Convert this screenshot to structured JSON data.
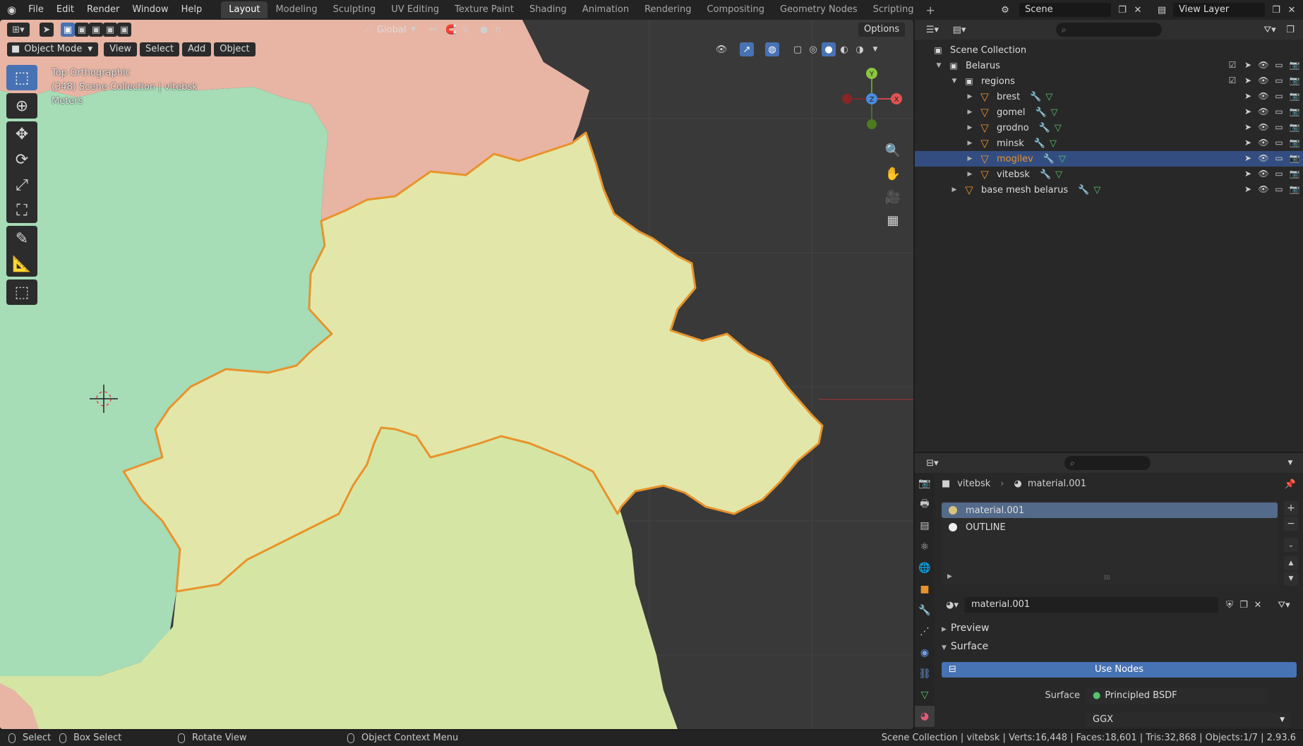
{
  "menus": [
    "File",
    "Edit",
    "Render",
    "Window",
    "Help"
  ],
  "workspaces": [
    "Layout",
    "Modeling",
    "Sculpting",
    "UV Editing",
    "Texture Paint",
    "Shading",
    "Animation",
    "Rendering",
    "Compositing",
    "Geometry Nodes",
    "Scripting"
  ],
  "active_workspace": "Layout",
  "scene_name": "Scene",
  "view_layer": "View Layer",
  "viewport": {
    "mode": "Object Mode",
    "menu": [
      "View",
      "Select",
      "Add",
      "Object"
    ],
    "orientation": "Global",
    "options": "Options",
    "overlay_view": "Top Orthographic",
    "overlay_collection": "(348) Scene Collection | vitebsk",
    "overlay_units": "Meters",
    "gizmo": {
      "x": "X",
      "y": "Y",
      "z": "Z"
    }
  },
  "outliner": {
    "root": "Scene Collection",
    "rows": [
      {
        "label": "Belarus",
        "kind": "collection"
      },
      {
        "label": "regions",
        "kind": "collection"
      },
      {
        "label": "brest",
        "kind": "mesh"
      },
      {
        "label": "gomel",
        "kind": "mesh"
      },
      {
        "label": "grodno",
        "kind": "mesh"
      },
      {
        "label": "minsk",
        "kind": "mesh"
      },
      {
        "label": "mogilev",
        "kind": "mesh",
        "selected": true
      },
      {
        "label": "vitebsk",
        "kind": "mesh"
      },
      {
        "label": "base mesh belarus",
        "kind": "mesh"
      }
    ]
  },
  "properties": {
    "object": "vitebsk",
    "material": "material.001",
    "slots": [
      {
        "label": "material.001",
        "color": "#d9c27a"
      },
      {
        "label": "OUTLINE",
        "color": "#eeeeee"
      }
    ],
    "datablock": "material.001",
    "panels": {
      "preview": "Preview",
      "surface": "Surface"
    },
    "use_nodes": "Use Nodes",
    "surface_label": "Surface",
    "surface_value": "Principled BSDF",
    "distribution": "GGX"
  },
  "statusbar": {
    "select": "Select",
    "box_select": "Box Select",
    "rotate": "Rotate View",
    "context": "Object Context Menu",
    "stats": "Scene Collection | vitebsk | Verts:16,448 | Faces:18,601 | Tris:32,868 | Objects:1/7 | 2.93.6"
  },
  "colors": {
    "accent": "#4772b3",
    "selection_row": "#334d80",
    "region_green": "#a6dcb6",
    "region_pink": "#e8b4a4",
    "region_yellow": "#e2e7a9",
    "region_lightgreen": "#d5e5a4",
    "active_outline": "#e8932c"
  }
}
